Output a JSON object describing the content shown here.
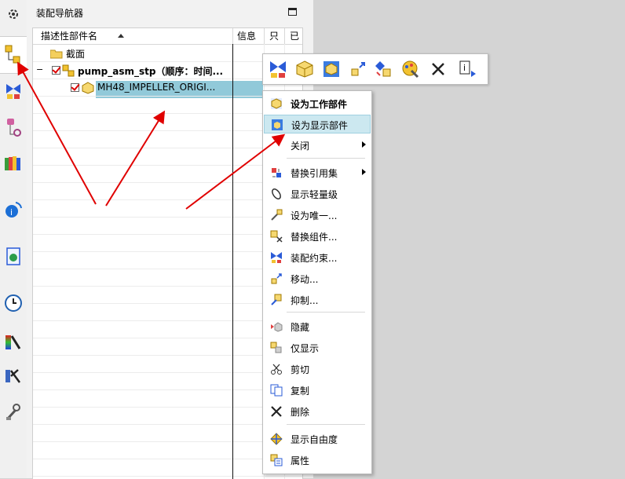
{
  "navigator": {
    "title": "装配导航器",
    "columns": [
      "描述性部件名",
      "信息",
      "只",
      "已"
    ],
    "nodes": {
      "section": "截面",
      "assembly": "pump_asm_stp（顺序：时间...",
      "part": "MH48_IMPELLER_ORIGI..."
    }
  },
  "toolbar_icons": [
    "assembly-constraints-icon",
    "component-icon",
    "display-part-icon",
    "move-icon",
    "replace-icon",
    "paint-icon",
    "delete-x-icon",
    "info-icon"
  ],
  "context_menu": {
    "items": [
      {
        "label": "设为工作部件",
        "icon": "work-part-icon",
        "bold": true
      },
      {
        "label": "设为显示部件",
        "icon": "display-part-icon",
        "highlighted": true
      },
      {
        "label": "关闭",
        "submenu": true
      },
      {
        "label": "替换引用集",
        "icon": "reference-set-icon",
        "submenu": true
      },
      {
        "label": "显示轻量级",
        "icon": "lightweight-icon"
      },
      {
        "label": "设为唯一...",
        "icon": "unique-icon"
      },
      {
        "label": "替换组件...",
        "icon": "replace-component-icon"
      },
      {
        "label": "装配约束...",
        "icon": "assembly-constraint-icon"
      },
      {
        "label": "移动...",
        "icon": "move-icon"
      },
      {
        "label": "抑制...",
        "icon": "suppress-icon"
      },
      {
        "label": "隐藏",
        "icon": "hide-icon"
      },
      {
        "label": "仅显示",
        "icon": "show-only-icon"
      },
      {
        "label": "剪切",
        "icon": "cut-icon"
      },
      {
        "label": "复制",
        "icon": "copy-icon"
      },
      {
        "label": "删除",
        "icon": "delete-icon"
      },
      {
        "label": "显示自由度",
        "icon": "dof-icon"
      },
      {
        "label": "属性",
        "icon": "properties-icon"
      }
    ]
  },
  "colors": {
    "selection": "#91c9d9",
    "menu_highlight": "#cce8f0",
    "arrow": "#e00000",
    "checkmark": "#dd0000"
  }
}
